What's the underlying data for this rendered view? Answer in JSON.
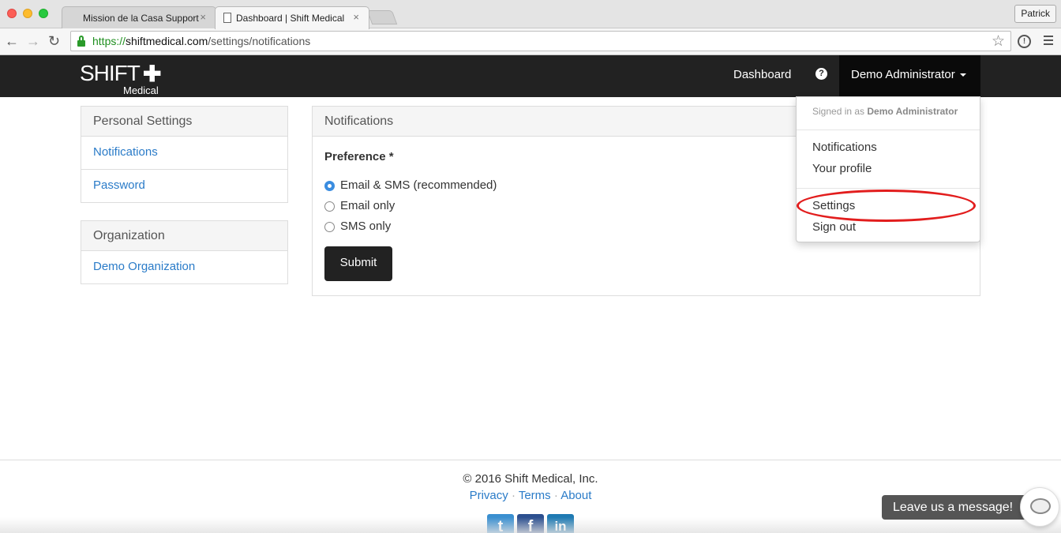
{
  "browser": {
    "tabs": [
      {
        "title": "Mission de la Casa Support",
        "close": "×"
      },
      {
        "title": "Dashboard | Shift Medical",
        "close": "×"
      }
    ],
    "user_button": "Patrick",
    "url_https": "https://",
    "url_host": "shiftmedical.com",
    "url_path": "/settings/notifications",
    "icons": [
      "back-arrow-icon",
      "forward-arrow-icon",
      "reload-icon",
      "lock-icon",
      "star-icon",
      "extension-icon",
      "menu-icon"
    ]
  },
  "navbar": {
    "logo_main": "SHIFT",
    "logo_plus": "✚",
    "logo_sub": "Medical",
    "dashboard": "Dashboard",
    "help_glyph": "?",
    "user": "Demo Administrator"
  },
  "sidebar": {
    "personal_heading": "Personal Settings",
    "personal_items": [
      "Notifications",
      "Password"
    ],
    "org_heading": "Organization",
    "org_items": [
      "Demo Organization"
    ]
  },
  "main": {
    "heading": "Notifications",
    "preference_label": "Preference *",
    "options": [
      {
        "label": "Email & SMS (recommended)",
        "selected": true
      },
      {
        "label": "Email only",
        "selected": false
      },
      {
        "label": "SMS only",
        "selected": false
      }
    ],
    "submit": "Submit"
  },
  "dropdown": {
    "signed_in_prefix": "Signed in as",
    "signed_in_user": "Demo Administrator",
    "items": [
      "Notifications",
      "Your profile",
      "Settings",
      "Sign out"
    ],
    "highlighted": "Settings"
  },
  "footer": {
    "copyright": "© 2016 Shift Medical, Inc.",
    "links": [
      "Privacy",
      "Terms",
      "About"
    ],
    "separator": " · ",
    "socials": [
      {
        "name": "twitter-icon",
        "glyph": "t",
        "color": "#3a8fd0"
      },
      {
        "name": "facebook-icon",
        "glyph": "f",
        "color": "#2c4f8f"
      },
      {
        "name": "linkedin-icon",
        "glyph": "in",
        "color": "#1f7ab3"
      }
    ]
  },
  "chat": {
    "label": "Leave us a message!"
  },
  "colors": {
    "navbar": "#222222",
    "link": "#2a7bc8",
    "highlight": "#e21d1d",
    "radio_selected": "#3b8de0"
  }
}
